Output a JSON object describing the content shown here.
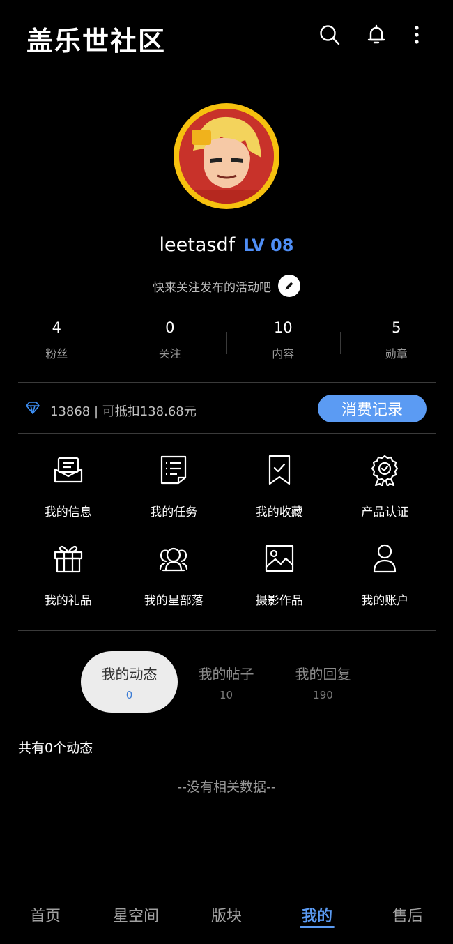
{
  "header": {
    "title": "盖乐世社区",
    "icons": [
      "search-icon",
      "bell-icon",
      "more-vertical-icon"
    ]
  },
  "profile": {
    "username": "leetasdf",
    "level": "LV 08",
    "bio": "快来关注发布的活动吧"
  },
  "stats": [
    {
      "value": "4",
      "label": "粉丝"
    },
    {
      "value": "0",
      "label": "关注"
    },
    {
      "value": "10",
      "label": "内容"
    },
    {
      "value": "5",
      "label": "勋章"
    }
  ],
  "points": {
    "text": "13868 | 可抵扣138.68元",
    "button_label": "消费记录"
  },
  "grid": [
    {
      "label": "我的信息",
      "icon": "message-icon"
    },
    {
      "label": "我的任务",
      "icon": "task-list-icon"
    },
    {
      "label": "我的收藏",
      "icon": "bookmark-icon"
    },
    {
      "label": "产品认证",
      "icon": "badge-icon"
    },
    {
      "label": "我的礼品",
      "icon": "gift-icon"
    },
    {
      "label": "我的星部落",
      "icon": "group-icon"
    },
    {
      "label": "摄影作品",
      "icon": "image-icon"
    },
    {
      "label": "我的账户",
      "icon": "user-icon"
    }
  ],
  "tabs": [
    {
      "label": "我的动态",
      "count": "0",
      "active": true
    },
    {
      "label": "我的帖子",
      "count": "10",
      "active": false
    },
    {
      "label": "我的回复",
      "count": "190",
      "active": false
    }
  ],
  "content": {
    "total": "共有0个动态",
    "empty": "--没有相关数据--"
  },
  "bottom_nav": [
    {
      "label": "首页",
      "active": false
    },
    {
      "label": "星空间",
      "active": false
    },
    {
      "label": "版块",
      "active": false
    },
    {
      "label": "我的",
      "active": true
    },
    {
      "label": "售后",
      "active": false
    }
  ],
  "colors": {
    "accent": "#5b9bf3",
    "level": "#4f8ef5",
    "avatar_ring": "#f6c10f"
  }
}
